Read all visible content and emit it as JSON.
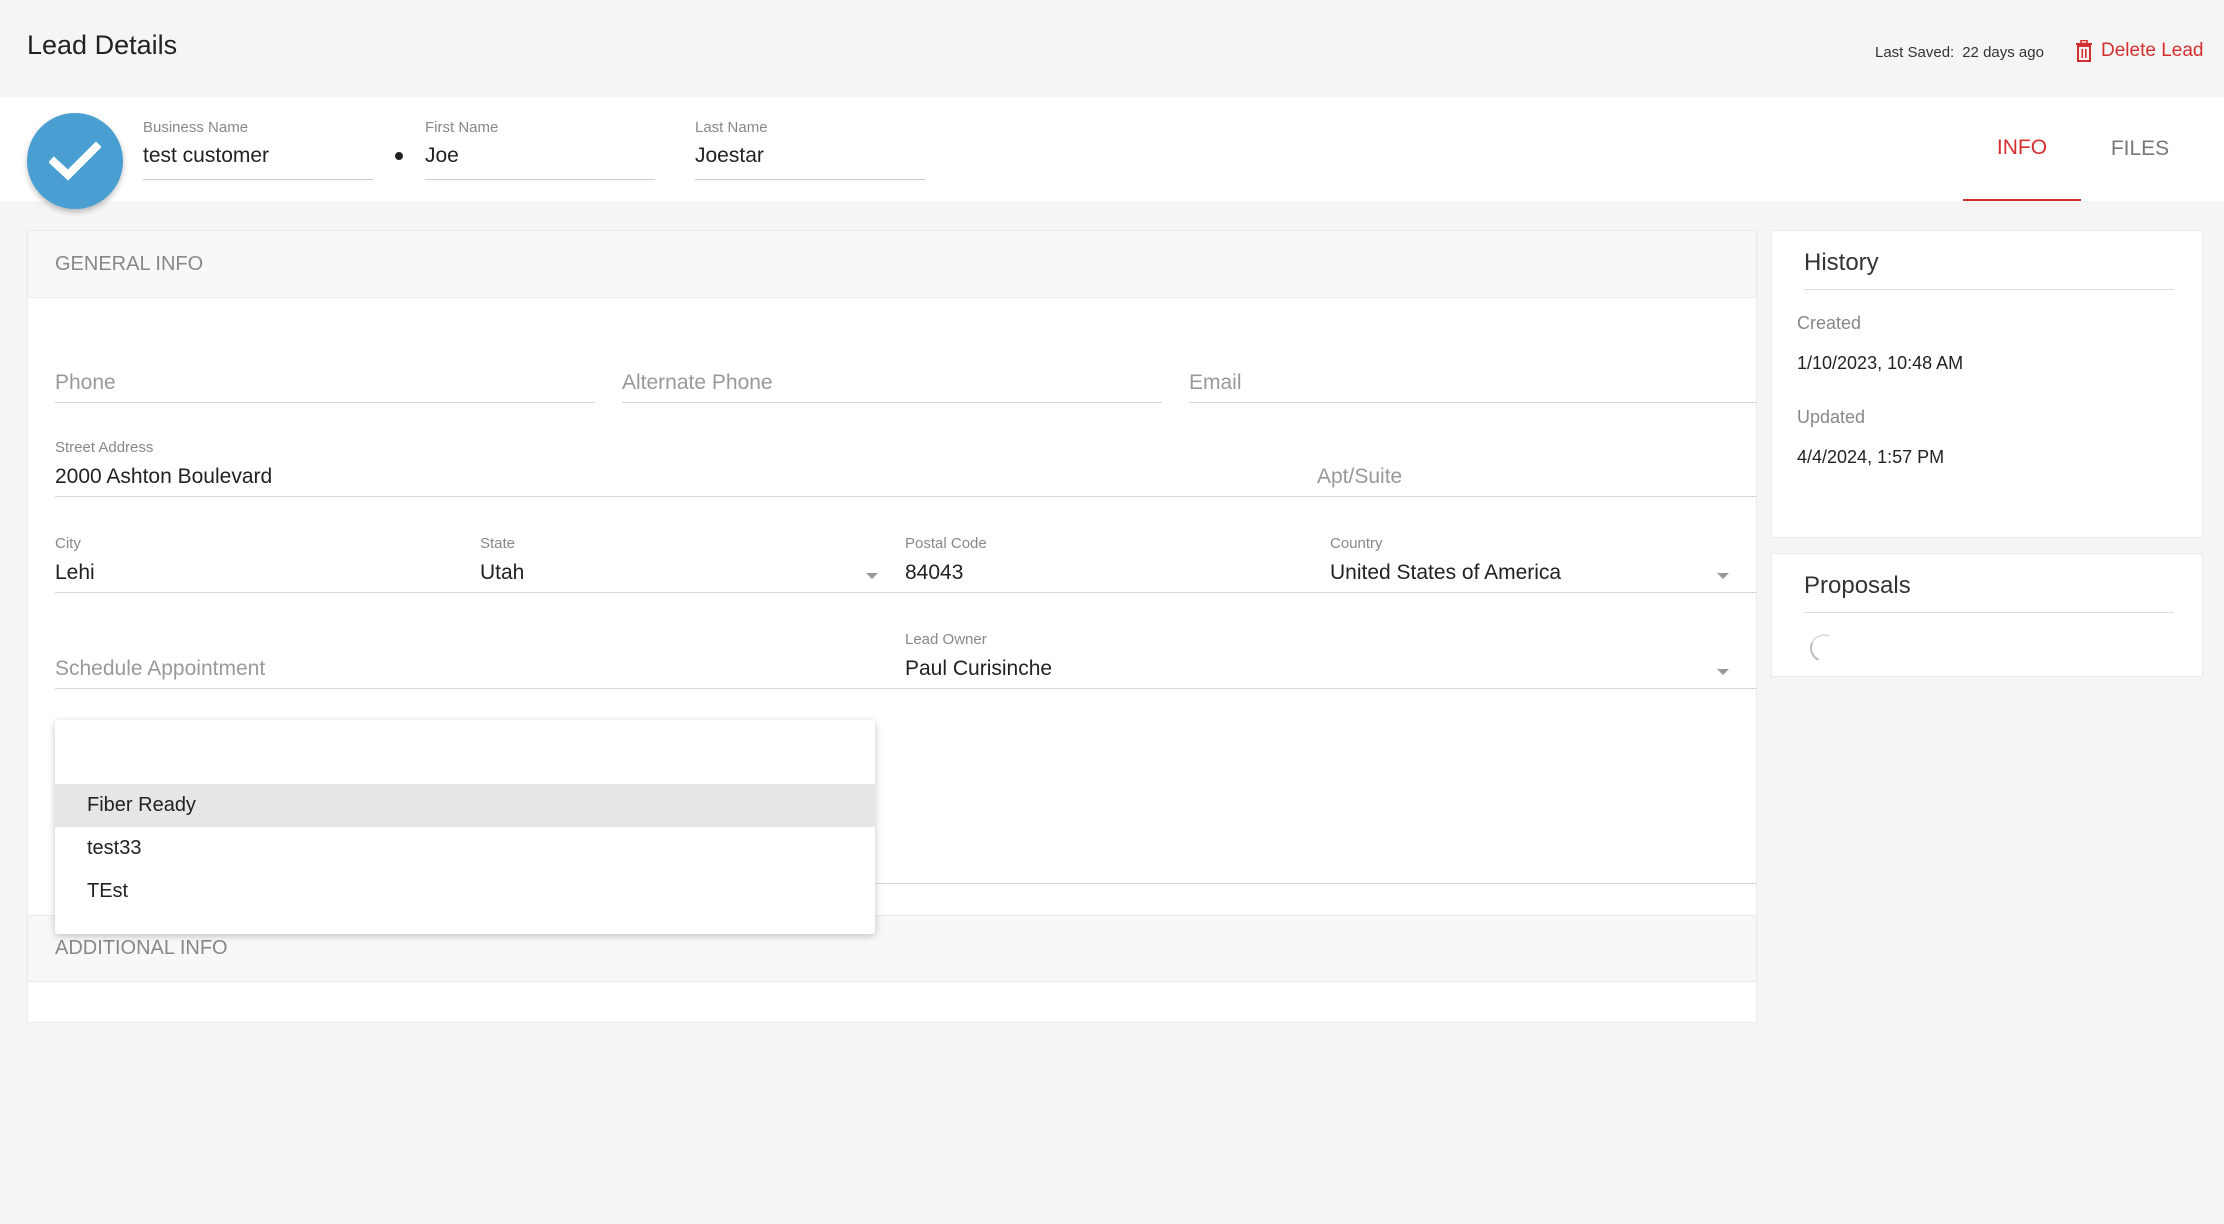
{
  "header": {
    "title": "Lead Details",
    "last_saved_label": "Last Saved:",
    "last_saved_value": "22 days ago",
    "delete_label": "Delete Lead"
  },
  "namebar": {
    "business_name_label": "Business Name",
    "business_name_value": "test customer",
    "first_name_label": "First Name",
    "first_name_value": "Joe",
    "last_name_label": "Last Name",
    "last_name_value": "Joestar",
    "tabs": [
      {
        "label": "INFO",
        "active": true
      },
      {
        "label": "FILES",
        "active": false
      }
    ]
  },
  "general_info": {
    "section_label": "GENERAL INFO",
    "phone_placeholder": "Phone",
    "alt_phone_placeholder": "Alternate Phone",
    "email_placeholder": "Email",
    "street_label": "Street Address",
    "street_value": "2000 Ashton Boulevard",
    "apt_placeholder": "Apt/Suite",
    "city_label": "City",
    "city_value": "Lehi",
    "state_label": "State",
    "state_value": "Utah",
    "postal_label": "Postal Code",
    "postal_value": "84043",
    "country_label": "Country",
    "country_value": "United States of America",
    "schedule_placeholder": "Schedule Appointment",
    "owner_label": "Lead Owner",
    "owner_value": "Paul Curisinche"
  },
  "dropdown": {
    "options": [
      "Fiber Ready",
      "test33",
      "TEst"
    ],
    "highlighted_index": 0
  },
  "additional_info": {
    "section_label": "ADDITIONAL INFO"
  },
  "history": {
    "title": "History",
    "created_label": "Created",
    "created_value": "1/10/2023, 10:48 AM",
    "updated_label": "Updated",
    "updated_value": "4/4/2024, 1:57 PM"
  },
  "proposals": {
    "title": "Proposals"
  },
  "colors": {
    "accent": "#d32f2f",
    "avatar": "#4a9fd2"
  }
}
